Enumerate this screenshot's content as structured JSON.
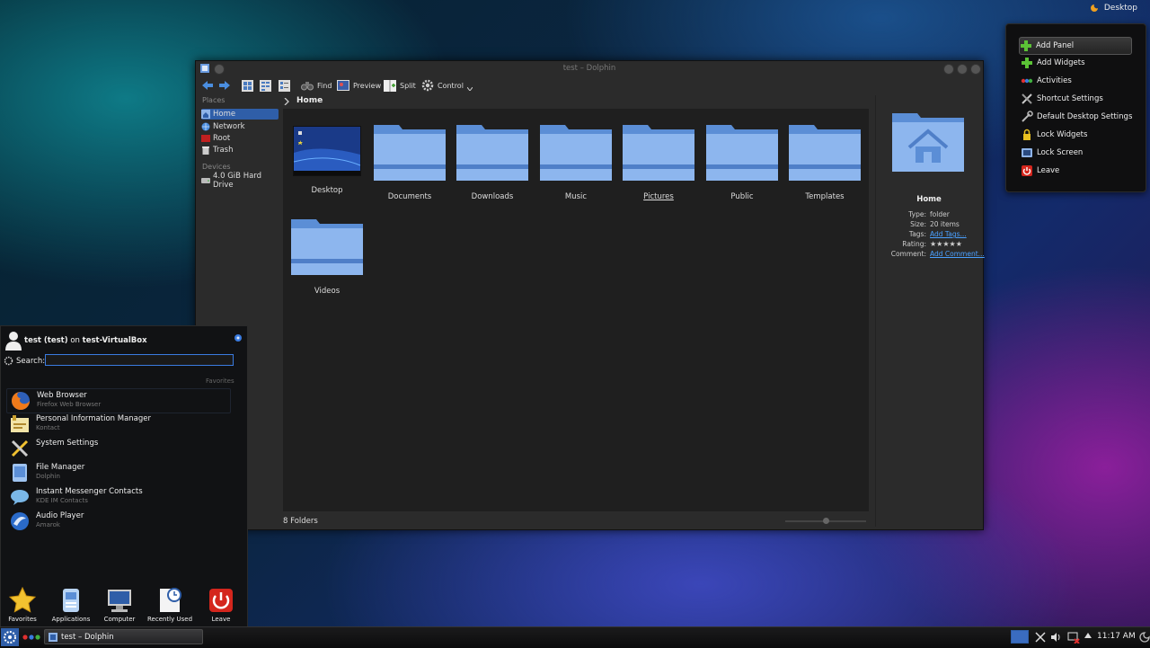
{
  "desktop": {
    "toolbox_label": "Desktop",
    "menu": {
      "items": [
        {
          "label": "Add Panel",
          "icon": "plus-icon",
          "selected": true
        },
        {
          "label": "Add Widgets",
          "icon": "plus-icon"
        },
        {
          "label": "Activities",
          "icon": "activities-icon"
        },
        {
          "label": "Shortcut Settings",
          "icon": "tools-icon"
        },
        {
          "label": "Default Desktop Settings",
          "icon": "wrench-icon"
        },
        {
          "label": "Lock Widgets",
          "icon": "lock-icon"
        },
        {
          "label": "Lock Screen",
          "icon": "lock-screen-icon"
        },
        {
          "label": "Leave",
          "icon": "power-icon"
        }
      ]
    }
  },
  "window": {
    "title": "test – Dolphin",
    "toolbar": {
      "find": "Find",
      "preview": "Preview",
      "split": "Split",
      "control": "Control"
    },
    "places": {
      "header": "Places",
      "items": [
        {
          "label": "Home",
          "icon": "home-icon",
          "selected": true
        },
        {
          "label": "Network",
          "icon": "network-icon"
        },
        {
          "label": "Root",
          "icon": "root-icon"
        },
        {
          "label": "Trash",
          "icon": "trash-icon"
        }
      ],
      "devices_header": "Devices",
      "devices": [
        {
          "label": "4.0 GiB Hard Drive",
          "icon": "hard-drive-icon"
        }
      ]
    },
    "breadcrumb": {
      "current": "Home"
    },
    "files": [
      {
        "name": "Desktop",
        "type": "desktop"
      },
      {
        "name": "Documents",
        "type": "folder"
      },
      {
        "name": "Downloads",
        "type": "folder"
      },
      {
        "name": "Music",
        "type": "folder"
      },
      {
        "name": "Pictures",
        "type": "folder"
      },
      {
        "name": "Public",
        "type": "folder"
      },
      {
        "name": "Templates",
        "type": "folder"
      },
      {
        "name": "Videos",
        "type": "folder"
      }
    ],
    "status": "8 Folders",
    "info": {
      "title": "Home",
      "type_label": "Type:",
      "type_value": "folder",
      "size_label": "Size:",
      "size_value": "20 items",
      "tags_label": "Tags:",
      "tags_value": "Add Tags...",
      "rating_label": "Rating:",
      "rating_stars": 5,
      "comment_label": "Comment:",
      "comment_value": "Add Comment..."
    }
  },
  "kickoff": {
    "user": "test (test)",
    "on": "on",
    "host": "test-VirtualBox",
    "search_label": "Search:",
    "search_value": "",
    "favorites_header": "Favorites",
    "favorites": [
      {
        "title": "Web Browser",
        "subtitle": "Firefox Web Browser",
        "icon": "firefox-icon"
      },
      {
        "title": "Personal Information Manager",
        "subtitle": "Kontact",
        "icon": "kontact-icon"
      },
      {
        "title": "System Settings",
        "subtitle": "",
        "icon": "system-settings-icon"
      },
      {
        "title": "File Manager",
        "subtitle": "Dolphin",
        "icon": "file-manager-icon"
      },
      {
        "title": "Instant Messenger Contacts",
        "subtitle": "KDE IM Contacts",
        "icon": "im-contacts-icon"
      },
      {
        "title": "Audio Player",
        "subtitle": "Amarok",
        "icon": "amarok-icon"
      }
    ],
    "tabs": [
      {
        "label": "Favorites",
        "icon": "star-icon"
      },
      {
        "label": "Applications",
        "icon": "applications-icon"
      },
      {
        "label": "Computer",
        "icon": "computer-icon"
      },
      {
        "label": "Recently Used",
        "icon": "recent-icon"
      },
      {
        "label": "Leave",
        "icon": "power-icon"
      }
    ]
  },
  "taskbar": {
    "task_label": "test – Dolphin",
    "clock": "11:17 AM",
    "colors": {
      "accent": "#2f5ea8",
      "folder": "#6a9be0",
      "leave": "#d4261d"
    }
  }
}
